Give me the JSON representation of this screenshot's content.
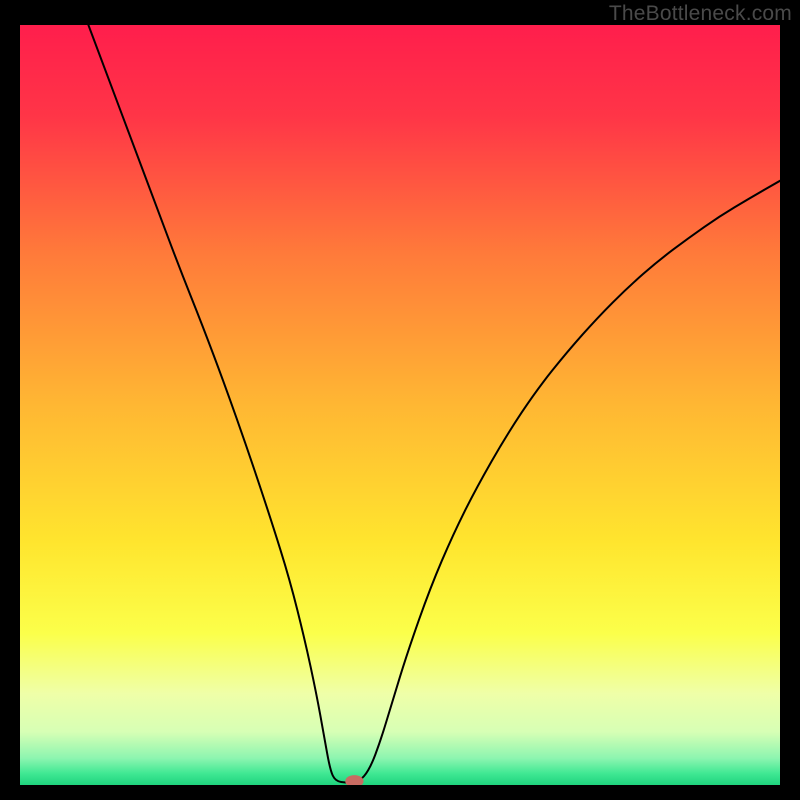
{
  "watermark": "TheBottleneck.com",
  "chart_data": {
    "type": "line",
    "title": "",
    "xlabel": "",
    "ylabel": "",
    "xlim": [
      0,
      100
    ],
    "ylim": [
      0,
      100
    ],
    "gradient_stops": [
      {
        "offset": 0,
        "color": "#ff1e4c"
      },
      {
        "offset": 0.12,
        "color": "#ff3547"
      },
      {
        "offset": 0.3,
        "color": "#ff7a3a"
      },
      {
        "offset": 0.5,
        "color": "#ffb733"
      },
      {
        "offset": 0.68,
        "color": "#ffe52e"
      },
      {
        "offset": 0.8,
        "color": "#fbff4a"
      },
      {
        "offset": 0.88,
        "color": "#efffa8"
      },
      {
        "offset": 0.93,
        "color": "#d7ffb5"
      },
      {
        "offset": 0.965,
        "color": "#8cf5b0"
      },
      {
        "offset": 0.985,
        "color": "#3fe893"
      },
      {
        "offset": 1.0,
        "color": "#1fd37d"
      }
    ],
    "series": [
      {
        "name": "bottleneck-curve",
        "points": [
          {
            "x": 9.0,
            "y": 100.0
          },
          {
            "x": 12.0,
            "y": 92.0
          },
          {
            "x": 15.0,
            "y": 84.0
          },
          {
            "x": 18.0,
            "y": 76.0
          },
          {
            "x": 21.0,
            "y": 68.0
          },
          {
            "x": 24.0,
            "y": 60.5
          },
          {
            "x": 27.0,
            "y": 52.5
          },
          {
            "x": 30.0,
            "y": 44.0
          },
          {
            "x": 33.0,
            "y": 35.0
          },
          {
            "x": 35.5,
            "y": 27.0
          },
          {
            "x": 37.5,
            "y": 19.0
          },
          {
            "x": 39.0,
            "y": 12.0
          },
          {
            "x": 40.0,
            "y": 6.5
          },
          {
            "x": 40.8,
            "y": 2.0
          },
          {
            "x": 41.5,
            "y": 0.5
          },
          {
            "x": 43.0,
            "y": 0.3
          },
          {
            "x": 44.5,
            "y": 0.3
          },
          {
            "x": 46.0,
            "y": 2.0
          },
          {
            "x": 47.5,
            "y": 6.0
          },
          {
            "x": 49.0,
            "y": 11.0
          },
          {
            "x": 51.0,
            "y": 17.5
          },
          {
            "x": 54.0,
            "y": 26.0
          },
          {
            "x": 57.0,
            "y": 33.0
          },
          {
            "x": 60.0,
            "y": 39.0
          },
          {
            "x": 64.0,
            "y": 46.0
          },
          {
            "x": 68.0,
            "y": 52.0
          },
          {
            "x": 72.0,
            "y": 57.0
          },
          {
            "x": 76.0,
            "y": 61.5
          },
          {
            "x": 80.0,
            "y": 65.5
          },
          {
            "x": 84.0,
            "y": 69.0
          },
          {
            "x": 88.0,
            "y": 72.0
          },
          {
            "x": 92.0,
            "y": 74.8
          },
          {
            "x": 96.0,
            "y": 77.2
          },
          {
            "x": 100.0,
            "y": 79.5
          }
        ]
      }
    ],
    "marker": {
      "x": 44.0,
      "y": 0.5,
      "rx": 1.2,
      "ry": 0.8,
      "color": "#c86b62"
    }
  }
}
